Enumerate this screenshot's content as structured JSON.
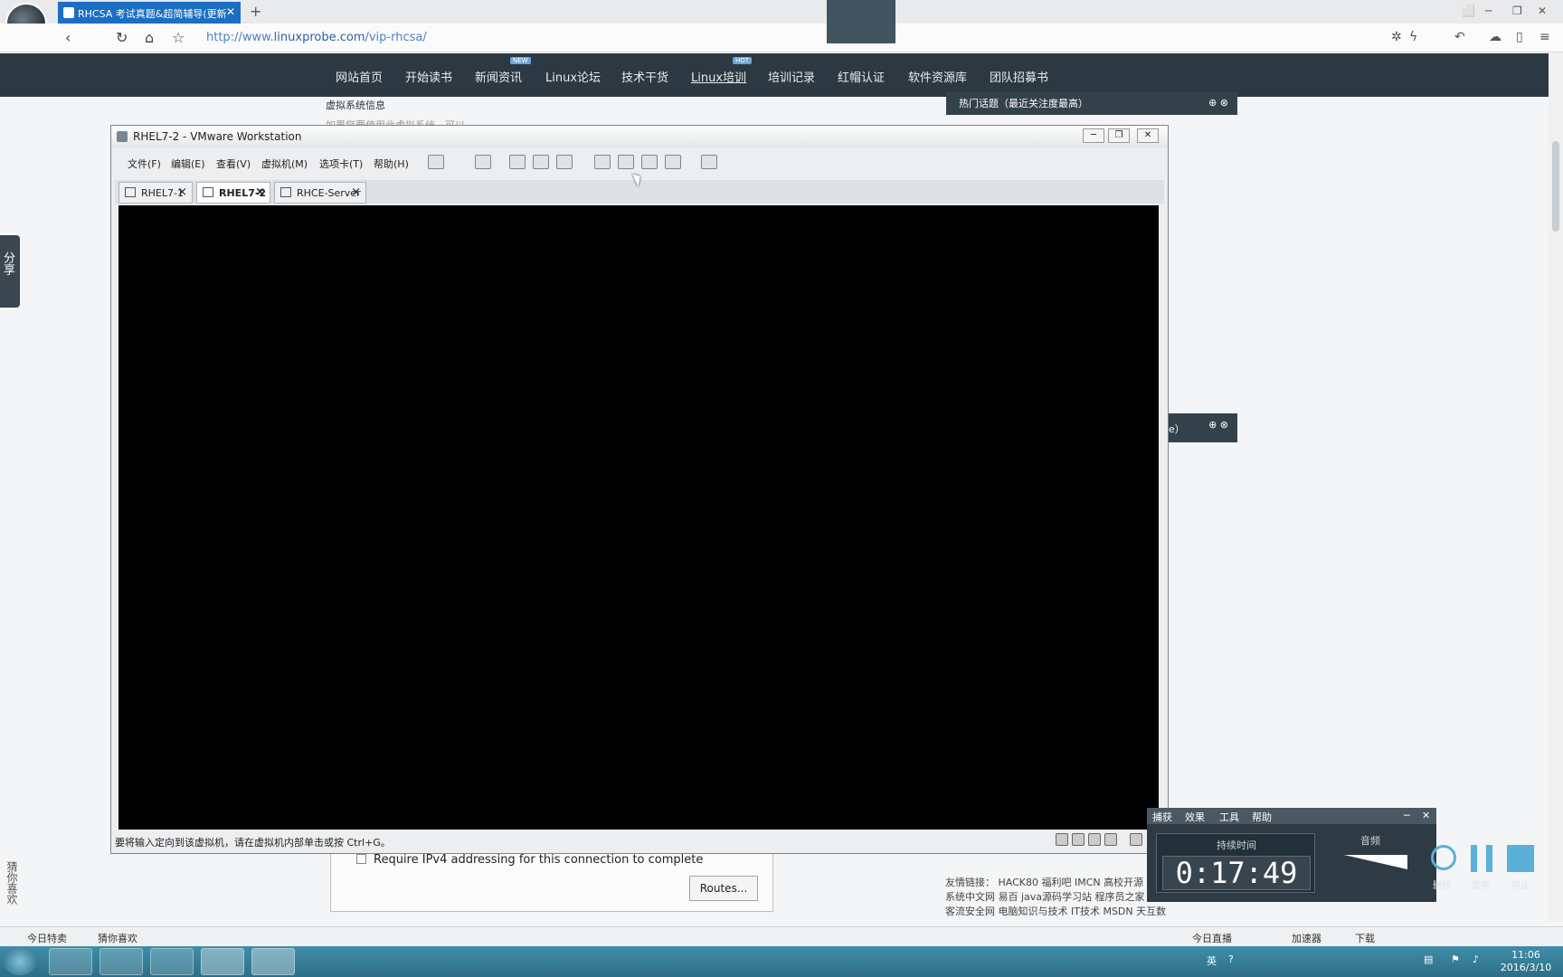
{
  "browser": {
    "tab_title": "RHCSA 考试真题&超简辅导(更新",
    "tab_close": "✕",
    "new_tab": "+",
    "url_prefix": "http://www.",
    "url_domain": "linuxprobe.com",
    "url_path": "/vip-rhcsa/",
    "win_controls": [
      "⬜",
      "─",
      "❐",
      "✕"
    ]
  },
  "site_nav": {
    "items": [
      "网站首页",
      "开始读书",
      "新闻资讯",
      "Linux论坛",
      "技术干货",
      "Linux培训",
      "培训记录",
      "红帽认证",
      "软件资源库",
      "团队招募书"
    ],
    "badge_new": "NEW",
    "badge_hot": "HOT"
  },
  "page": {
    "line1": "虚拟系统信息",
    "line2": "如果您要使用此虚拟系统，可以...",
    "hot_topics": "热门话题（最近关注度最高）",
    "hot_topics2": "e）",
    "share": "分享",
    "guess": "猜你喜欢",
    "ipv4": "Require IPv4 addressing for this connection to complete",
    "routes_btn": "Routes...",
    "friend_links": [
      "友情链接： HACK80 福利吧 IMCN 高校开源",
      "系统中文网 易百 java源码学习站 程序员之家",
      "客流安全网 电脑知识与技术 IT技术 MSDN 天互数"
    ]
  },
  "vmware": {
    "title": "RHEL7-2 - VMware Workstation",
    "title_btns": [
      "─",
      "❐",
      "✕"
    ],
    "menu": [
      "文件(F)",
      "编辑(E)",
      "查看(V)",
      "虚拟机(M)",
      "选项卡(T)",
      "帮助(H)"
    ],
    "tabs": [
      {
        "label": "RHEL7-1"
      },
      {
        "label": "RHEL7-2"
      },
      {
        "label": "RHCE-Server"
      }
    ],
    "status": "要将输入定向到该虚拟机，请在虚拟机内部单击或按 Ctrl+G。"
  },
  "recorder": {
    "menu": [
      "捕获",
      "效果",
      "工具",
      "帮助"
    ],
    "duration_label": "持续时间",
    "time": "0:17:49",
    "audio_label": "音频",
    "buttons": [
      "删除",
      "暂停",
      "停止"
    ],
    "close": "✕",
    "minimize": "─"
  },
  "strip": {
    "left": [
      "今日特卖",
      "猜你喜欢"
    ],
    "right": [
      "今日直播",
      "加速器",
      "下载"
    ]
  },
  "taskbar": {
    "time": "11:06",
    "date": "2016/3/10",
    "ime": "英"
  }
}
